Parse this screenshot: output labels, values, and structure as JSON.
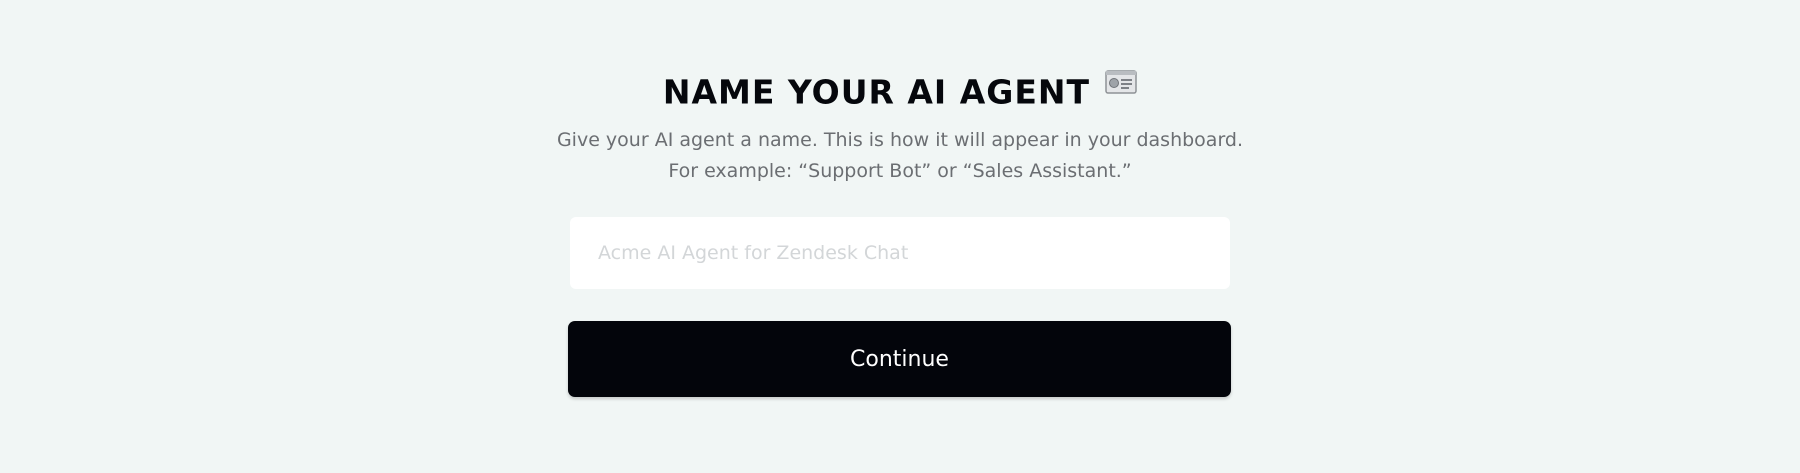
{
  "header": {
    "title": "NAME YOUR AI AGENT",
    "title_icon": "id-card-icon"
  },
  "description": {
    "line1": "Give your AI agent a name. This is how it will appear in your dashboard.",
    "line2": "For example: “Support Bot” or “Sales Assistant.”"
  },
  "form": {
    "agent_name_value": "",
    "agent_name_placeholder": "Acme AI Agent for Zendesk Chat",
    "continue_label": "Continue"
  },
  "colors": {
    "background": "#f1f6f5",
    "button": "#03050b",
    "title": "#05070c",
    "subtitle": "#6b6e72",
    "placeholder": "#d3d6d8"
  }
}
